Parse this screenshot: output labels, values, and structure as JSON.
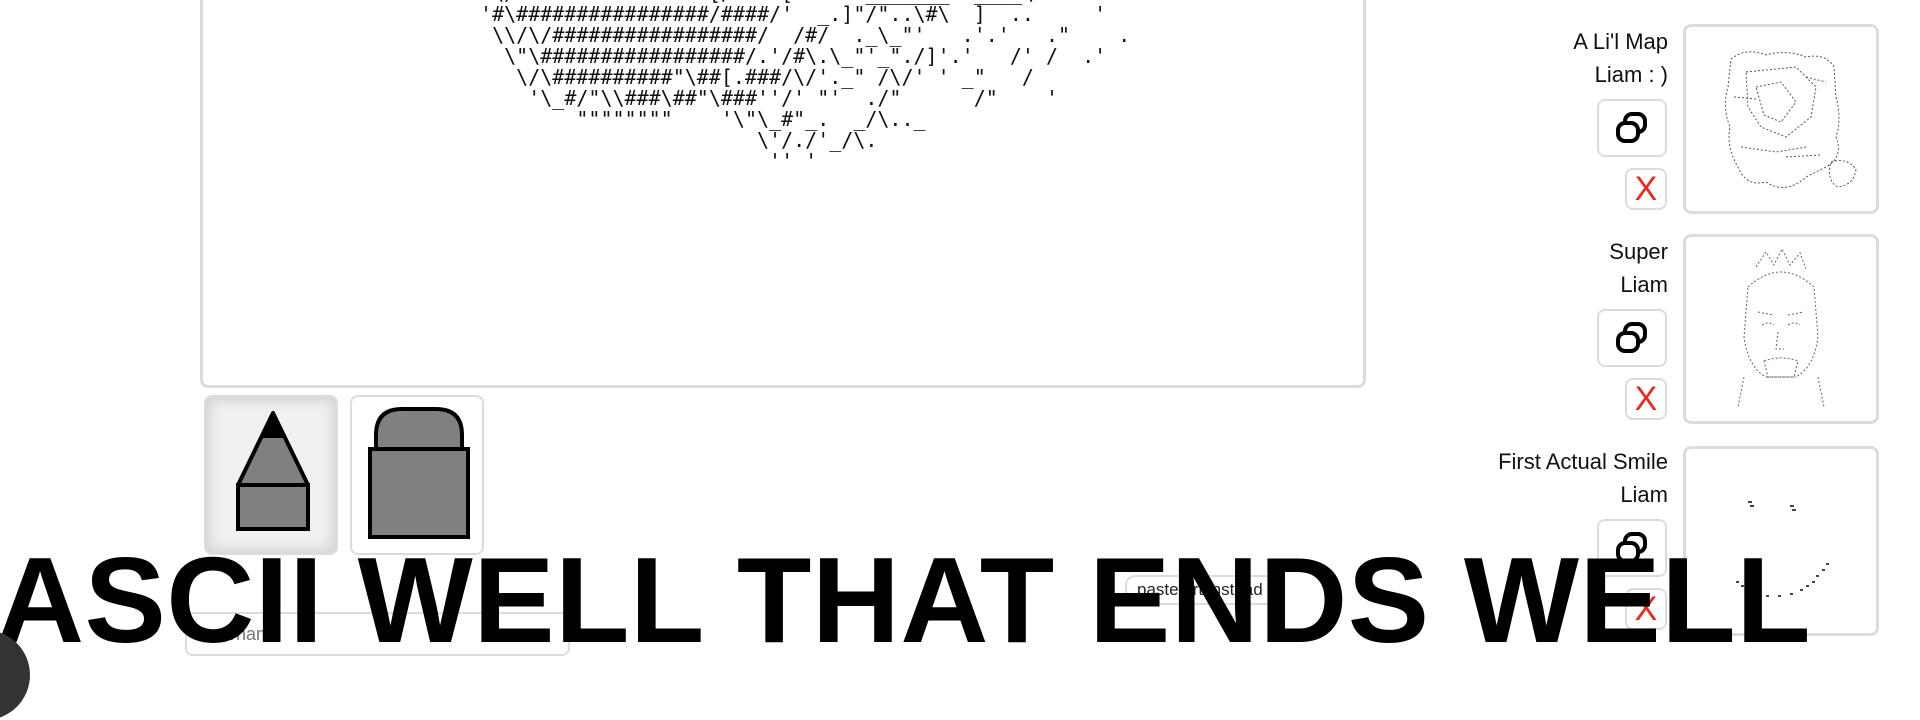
{
  "canvas": {
    "ascii_lines": [
      "'\"\\/################[/.###[     ._______\".____\\..     .\"",
      " '#\\################/####/'  _.]\"/\"..\\#\\  ]  ..     '",
      "  \\\\/\\/#################/  /#/  ._\\_\"'   .'.'   .\"    .",
      "   \\\"\\#################/.'/#\\.\\_\"'_\"./]'.'   /' /  .'",
      "    \\/\\##########\"\\##[.###/\\/'._\" /\\/' ' _\"   /",
      "     '\\_#/\"\\\\###\\##\"\\###''/' \"'  ./\"      /\"    '",
      "         \"\"\"\"\"\"\"\"    '\\\"\\_#\"_.  _/\\.._",
      "                        \\'/./'_/\\.",
      "                         '' '"
    ]
  },
  "tools": {
    "pencil": {
      "icon": "pencil-icon",
      "active": true
    },
    "eraser": {
      "icon": "eraser-icon",
      "active": false
    }
  },
  "gallery": [
    {
      "title": "A Li'l Map",
      "author": "Liam : )",
      "delete_label": "X"
    },
    {
      "title": "Super",
      "author": "Liam",
      "delete_label": "X"
    },
    {
      "title": "First Actual Smile",
      "author": "Liam",
      "delete_label": "X"
    }
  ],
  "paste_button": "paste art instead",
  "name_input": {
    "placeholder": "username",
    "value": ""
  },
  "banner": "ASCII WELL THAT ENDS WELL",
  "colors": {
    "border": "#dcdcdc",
    "delete": "#e8291c",
    "tool_fill": "#808080"
  }
}
